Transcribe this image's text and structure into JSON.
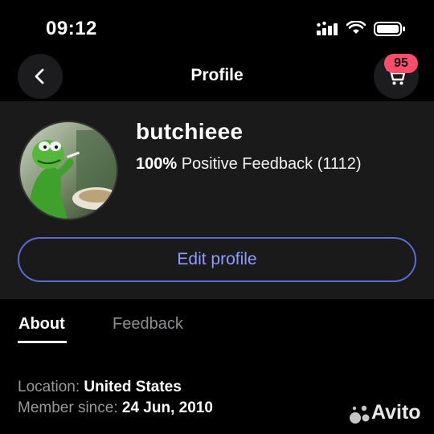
{
  "status_bar": {
    "time": "09:12"
  },
  "header": {
    "title": "Profile",
    "cart_count": "95"
  },
  "profile": {
    "username": "butchieee",
    "feedback_percent": "100%",
    "feedback_label": "Positive Feedback (1112)",
    "edit_label": "Edit profile"
  },
  "tabs": [
    {
      "label": "About",
      "active": true
    },
    {
      "label": "Feedback",
      "active": false
    }
  ],
  "about": {
    "location_label": "Location:",
    "location_value": "United States",
    "member_label": "Member since:",
    "member_value": "24 Jun, 2010"
  },
  "watermark": {
    "text": "Avito"
  },
  "colors": {
    "background": "#000000",
    "panel": "#1a1a1a",
    "accent": "#8c9dff",
    "badge": "#ff4d6a",
    "muted": "#9a9a9a"
  }
}
